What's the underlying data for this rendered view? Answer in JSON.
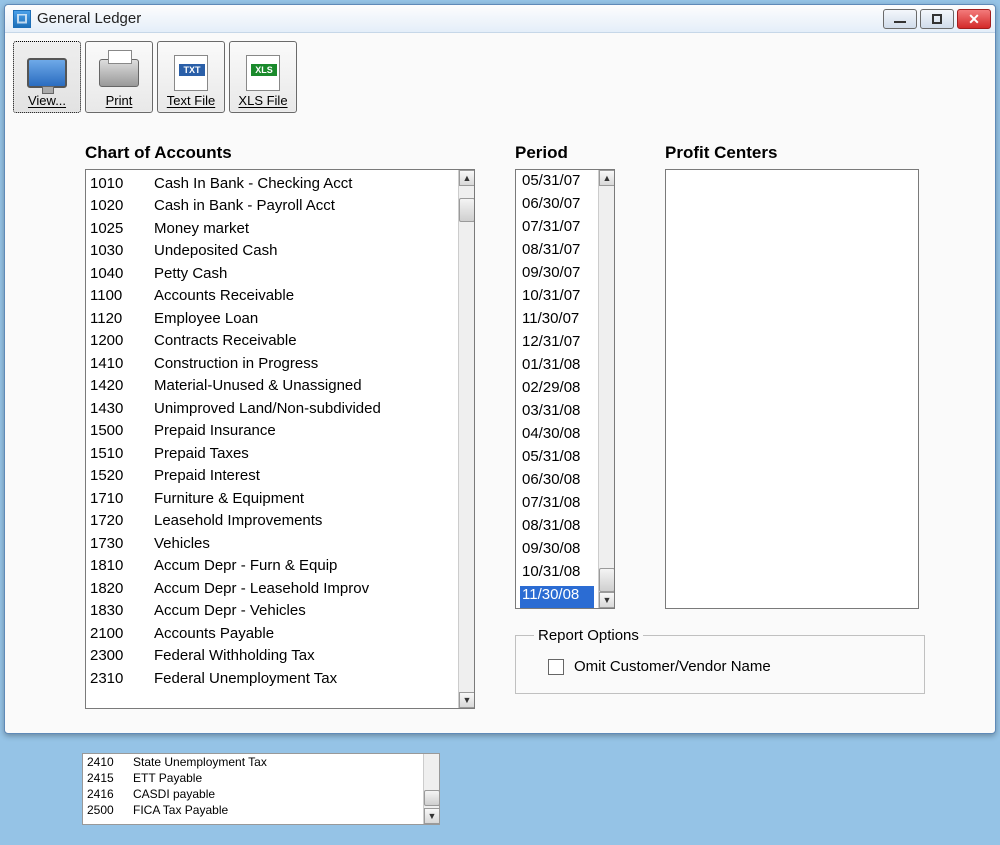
{
  "window": {
    "title": "General Ledger"
  },
  "toolbar": {
    "view": "View...",
    "print": "Print",
    "txt": "Text File",
    "xls": "XLS File",
    "txt_badge": "TXT",
    "xls_badge": "XLS"
  },
  "labels": {
    "chart": "Chart of Accounts",
    "period": "Period",
    "centers": "Profit Centers",
    "report_options": "Report Options",
    "omit": "Omit Customer/Vendor Name"
  },
  "accounts": [
    {
      "code": "1010",
      "name": "Cash In Bank - Checking Acct"
    },
    {
      "code": "1020",
      "name": "Cash in Bank - Payroll Acct"
    },
    {
      "code": "1025",
      "name": "Money market"
    },
    {
      "code": "1030",
      "name": "Undeposited Cash"
    },
    {
      "code": "1040",
      "name": "Petty Cash"
    },
    {
      "code": "1100",
      "name": "Accounts Receivable"
    },
    {
      "code": "1120",
      "name": "Employee Loan"
    },
    {
      "code": "1200",
      "name": "Contracts Receivable"
    },
    {
      "code": "1410",
      "name": "Construction in Progress"
    },
    {
      "code": "1420",
      "name": "Material-Unused & Unassigned"
    },
    {
      "code": "1430",
      "name": "Unimproved Land/Non-subdivided"
    },
    {
      "code": "1500",
      "name": "Prepaid Insurance"
    },
    {
      "code": "1510",
      "name": "Prepaid Taxes"
    },
    {
      "code": "1520",
      "name": "Prepaid Interest"
    },
    {
      "code": "1710",
      "name": "Furniture & Equipment"
    },
    {
      "code": "1720",
      "name": "Leasehold Improvements"
    },
    {
      "code": "1730",
      "name": "Vehicles"
    },
    {
      "code": "1810",
      "name": "Accum Depr - Furn & Equip"
    },
    {
      "code": "1820",
      "name": "Accum Depr - Leasehold Improv"
    },
    {
      "code": "1830",
      "name": "Accum Depr - Vehicles"
    },
    {
      "code": "2100",
      "name": "Accounts Payable"
    },
    {
      "code": "2300",
      "name": "Federal Withholding Tax"
    },
    {
      "code": "2310",
      "name": "Federal Unemployment Tax"
    }
  ],
  "periods": [
    "05/31/07",
    "06/30/07",
    "07/31/07",
    "08/31/07",
    "09/30/07",
    "10/31/07",
    "11/30/07",
    "12/31/07",
    "01/31/08",
    "02/29/08",
    "03/31/08",
    "04/30/08",
    "05/31/08",
    "06/30/08",
    "07/31/08",
    "08/31/08",
    "09/30/08",
    "10/31/08",
    "11/30/08"
  ],
  "period_selected": "11/30/08",
  "bg_accounts": [
    {
      "code": "2410",
      "name": "State Unemployment Tax"
    },
    {
      "code": "2415",
      "name": "ETT Payable"
    },
    {
      "code": "2416",
      "name": "CASDI payable"
    },
    {
      "code": "2500",
      "name": "FICA Tax Payable"
    }
  ]
}
